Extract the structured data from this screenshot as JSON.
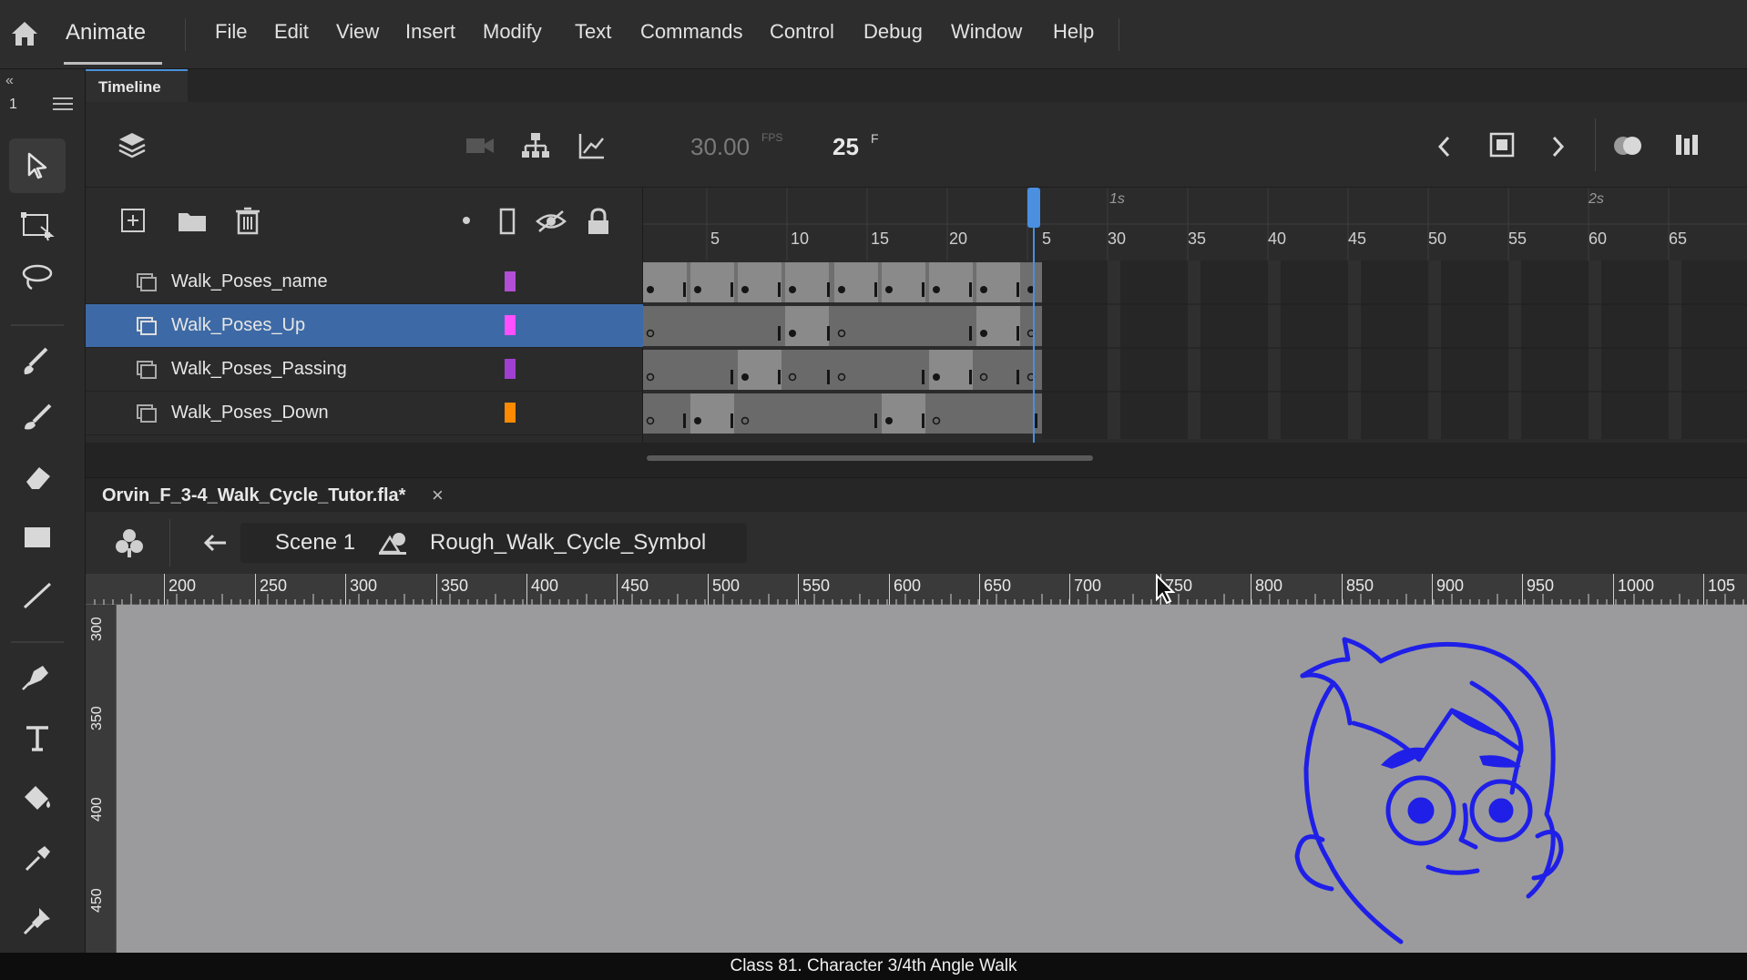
{
  "app": {
    "name": "Animate"
  },
  "menu": [
    "File",
    "Edit",
    "View",
    "Insert",
    "Modify",
    "Text",
    "Commands",
    "Control",
    "Debug",
    "Window",
    "Help"
  ],
  "toolbar": {
    "collapse_label": "«",
    "workspace_number": "1"
  },
  "timeline": {
    "tab_label": "Timeline",
    "fps": "30.00",
    "fps_unit": "FPS",
    "current_frame": "25",
    "frame_unit": "F",
    "ruler_numbers": [
      "5",
      "10",
      "15",
      "20",
      "5",
      "30",
      "35",
      "40",
      "45",
      "50",
      "55",
      "60",
      "65"
    ],
    "ruler_seconds": [
      "1s",
      "2s"
    ],
    "layers": [
      {
        "name": "Walk_Poses_name",
        "color": "#b24fd6",
        "selected": false
      },
      {
        "name": "Walk_Poses_Up",
        "color": "#ff4fff",
        "selected": true
      },
      {
        "name": "Walk_Poses_Passing",
        "color": "#a040d0",
        "selected": false
      },
      {
        "name": "Walk_Poses_Down",
        "color": "#ff8a00",
        "selected": false
      }
    ]
  },
  "document": {
    "tab_name": "Orvin_F_3-4_Walk_Cycle_Tutor.fla*",
    "close_label": "×",
    "scene": "Scene 1",
    "symbol": "Rough_Walk_Cycle_Symbol"
  },
  "rulers": {
    "top": [
      "200",
      "250",
      "300",
      "350",
      "400",
      "450",
      "500",
      "550",
      "600",
      "650",
      "700",
      "750",
      "800",
      "850",
      "900",
      "950",
      "1000",
      "105"
    ],
    "left": [
      "300",
      "350",
      "400",
      "450"
    ]
  },
  "caption": "Class 81. Character 3/4th Angle Walk",
  "colors": {
    "accent": "#3d6aa6",
    "stage": "#9b9b9d",
    "drawing": "#1f1fe8",
    "playhead": "#4a8fe0"
  }
}
